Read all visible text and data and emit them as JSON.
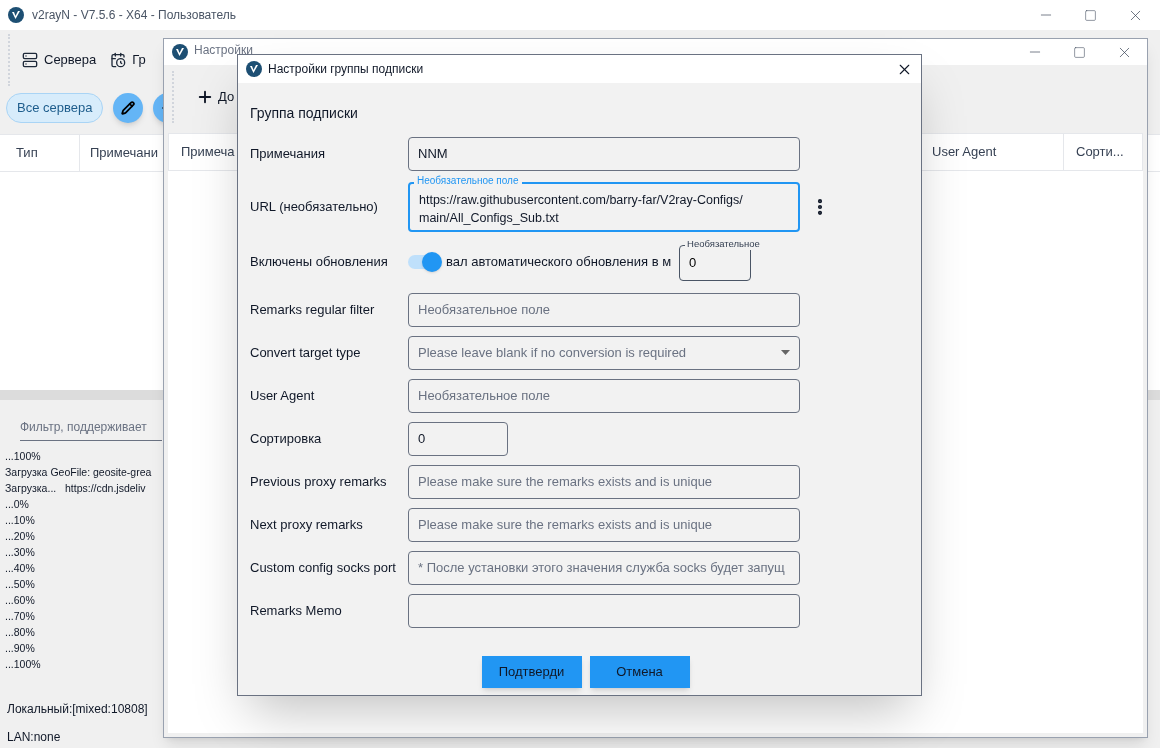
{
  "main_window": {
    "title": "v2rayN - V7.5.6 - X64 - Пользователь",
    "toolbar": [
      {
        "label": "Сервера",
        "kind": "servers"
      },
      {
        "label": "Гр",
        "kind": "groups"
      }
    ],
    "chips": [
      {
        "label": "Все сервера",
        "selected": true
      }
    ],
    "round_buttons": [
      {
        "kind": "edit"
      },
      {
        "kind": "add"
      }
    ],
    "table": {
      "columns": [
        "Тип",
        "Примечани"
      ]
    },
    "filter": {
      "placeholder": "Фильтр, поддерживает"
    },
    "log": [
      "...100%",
      "Загрузка GeoFile: geosite-grea",
      "Загрузка...   https://cdn.jsdeliv",
      "...0%",
      "...10%",
      "...20%",
      "...30%",
      "...40%",
      "...50%",
      "...60%",
      "...70%",
      "...80%",
      "...90%",
      "...100%"
    ],
    "status_bar": [
      "Локальный:[mixed:10808]",
      "LAN:none"
    ]
  },
  "sub_window": {
    "title": "Настройки",
    "toolbar": [
      {
        "label": "До",
        "kind": "add"
      }
    ],
    "table": {
      "columns": [
        "Примеча",
        "User Agent",
        "Сорти..."
      ]
    }
  },
  "dialog": {
    "title": "Настройки группы подписки",
    "section": "Группа подписки",
    "rows": [
      {
        "kind": "text",
        "label": "Примечания",
        "value": "NNM"
      },
      {
        "kind": "url",
        "label": "URL (необязательно)",
        "floating_label": "Необязательное поле",
        "value": "https://raw.githubusercontent.com/barry-far/V2ray-Configs/ main/All_Configs_Sub.txt",
        "focused": true
      },
      {
        "kind": "toggle",
        "label": "Включены обновления",
        "on": true,
        "interval_label": "вал автоматического обновления в м",
        "floating_label": "Необязательное",
        "value": "0"
      },
      {
        "kind": "text",
        "label": "Remarks regular filter",
        "placeholder": "Необязательное поле"
      },
      {
        "kind": "select",
        "label": "Convert target type",
        "placeholder": "Please leave blank if no conversion is required"
      },
      {
        "kind": "text",
        "label": "User Agent",
        "placeholder": "Необязательное поле"
      },
      {
        "kind": "number",
        "label": "Сортировка",
        "value": "0"
      },
      {
        "kind": "text",
        "label": "Previous proxy remarks",
        "placeholder": "Please make sure the remarks exists and is unique"
      },
      {
        "kind": "text",
        "label": "Next proxy remarks",
        "placeholder": "Please make sure the remarks exists and is unique"
      },
      {
        "kind": "text",
        "label": "Custom config socks port",
        "placeholder": "* После установки этого значения служба socks будет запущ"
      },
      {
        "kind": "text",
        "label": "Remarks Memo"
      }
    ],
    "buttons": [
      "Подтверди",
      "Отмена"
    ]
  }
}
